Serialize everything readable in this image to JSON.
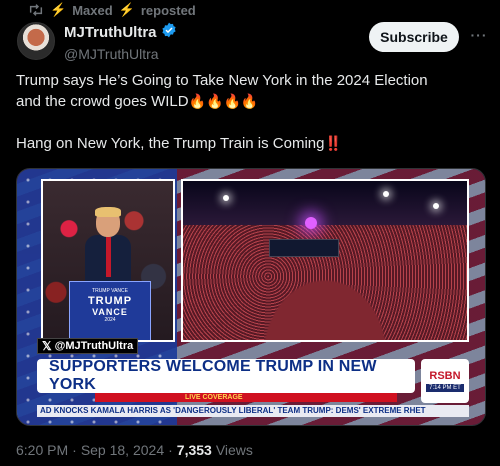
{
  "repost": {
    "user": "Maxed",
    "label": "reposted",
    "icon": "repost-icon"
  },
  "author": {
    "name": "MJTruthUltra",
    "handle": "@MJTruthUltra",
    "verified": true,
    "badge_color": "#1d9bf0"
  },
  "actions": {
    "subscribe_label": "Subscribe",
    "more_icon": "more-icon"
  },
  "tweet": {
    "line1": "Trump says He’s Going to Take New York in the 2024 Election",
    "line2": "and the crowd goes WILD",
    "line2_emoji": "🔥🔥🔥🔥",
    "line3": "Hang on New York, the Trump Train is Coming",
    "line3_emoji": "‼️"
  },
  "media": {
    "podium_top": "TRUMP VANCE",
    "podium_main": "TRUMP",
    "podium_sub": "VANCE",
    "podium_year": "2024",
    "watermark": "@MJTruthUltra",
    "headline": "SUPPORTERS WELCOME TRUMP IN NEW YORK",
    "live_label": "LIVE COVERAGE",
    "network": "RSBN",
    "network_time": "7:14 PM ET",
    "ticker": "AD KNOCKS KAMALA HARRIS AS 'DANGEROUSLY LIBERAL'   TEAM TRUMP: DEMS' EXTREME RHET"
  },
  "meta": {
    "time": "6:20 PM",
    "sep": "·",
    "date": "Sep 18, 2024",
    "sep2": "·",
    "views": "7,353",
    "views_label": "Views"
  },
  "colors": {
    "background": "#000000",
    "text": "#e7e9ea",
    "secondary": "#71767b",
    "accent": "#1d9bf0"
  }
}
